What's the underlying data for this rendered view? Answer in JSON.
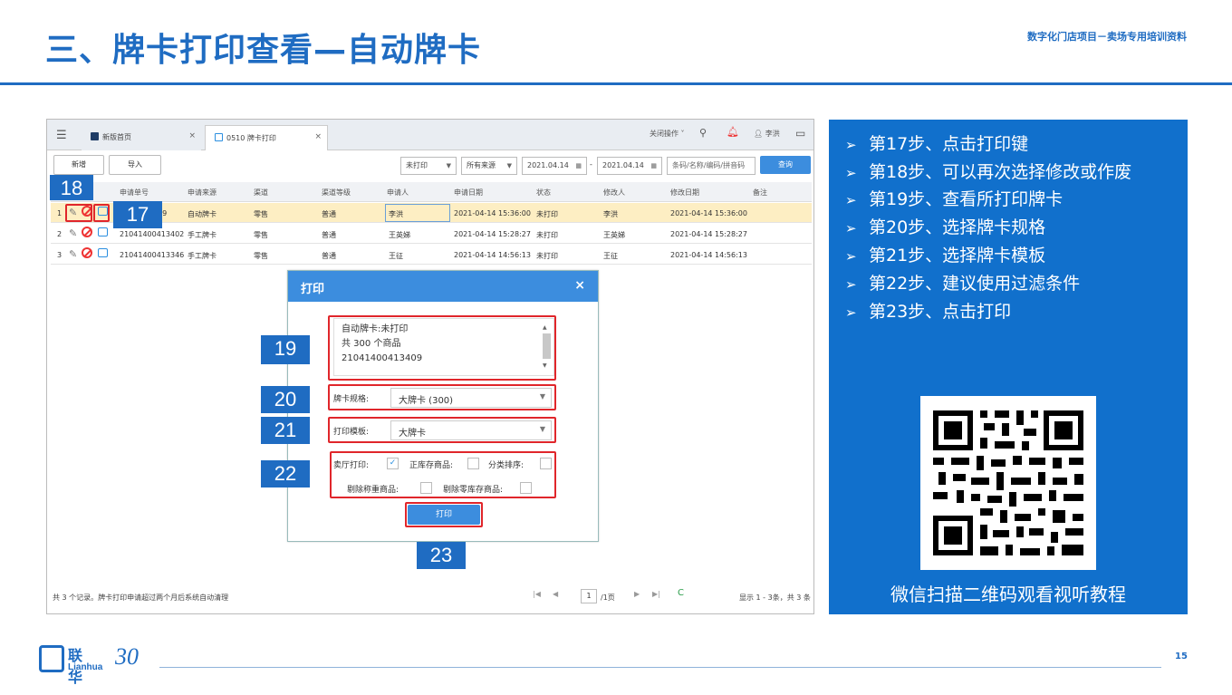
{
  "slide": {
    "title": "三、牌卡打印查看—自动牌卡",
    "subtitle": "数字化门店项目－卖场专用培训资料",
    "page_number": "15",
    "logo_cn": "联华",
    "logo_en": "Lianhua",
    "logo_30": "30"
  },
  "app": {
    "tabs": [
      {
        "label": "新版首页",
        "close": "×"
      },
      {
        "label": "0510 牌卡打印",
        "close": "×"
      }
    ],
    "topbar": {
      "close_ops": "关闭操作 ˅",
      "user": "李洪"
    },
    "toolbar": {
      "new_label": "新增",
      "import_label": "导入",
      "status_filter": "未打印",
      "source_filter": "所有来源",
      "date_from": "2021.04.14",
      "date_sep": "-",
      "date_to": "2021.04.14",
      "search_placeholder": "条码/名称/编码/拼音码",
      "query_label": "查询"
    },
    "columns": [
      "申请单号",
      "申请来源",
      "渠道",
      "渠道等级",
      "申请人",
      "申请日期",
      "状态",
      "修改人",
      "修改日期",
      "备注"
    ],
    "rows": [
      {
        "idx": "1",
        "id": "21041400413409",
        "id_visible": "409",
        "source": "自动牌卡",
        "channel": "零售",
        "level": "普通",
        "applicant": "李洪",
        "date": "2021-04-14 15:36:00",
        "status": "未打印",
        "modifier": "李洪",
        "mod_date": "2021-04-14 15:36:00"
      },
      {
        "idx": "2",
        "id": "21041400413402",
        "source": "手工牌卡",
        "channel": "零售",
        "level": "普通",
        "applicant": "王英娣",
        "date": "2021-04-14 15:28:27",
        "status": "未打印",
        "modifier": "王英娣",
        "mod_date": "2021-04-14 15:28:27"
      },
      {
        "idx": "3",
        "id": "21041400413346",
        "source": "手工牌卡",
        "channel": "零售",
        "level": "普通",
        "applicant": "王征",
        "date": "2021-04-14 14:56:13",
        "status": "未打印",
        "modifier": "王征",
        "mod_date": "2021-04-14 14:56:13"
      }
    ],
    "footer": {
      "record_note": "共 3 个记录。牌卡打印申请超过两个月后系统自动清理",
      "page": "1",
      "page_total": "/1页",
      "summary": "显示 1 - 3条，共 3 条"
    }
  },
  "dialog": {
    "title": "打印",
    "close": "×",
    "text_lines": [
      "自动牌卡:未打印",
      "共 300 个商品",
      "21041400413409"
    ],
    "spec_label": "牌卡规格:",
    "spec_value": "大牌卡 (300)",
    "template_label": "打印模板:",
    "template_value": "大牌卡",
    "opt_hall": "卖厅打印:",
    "opt_positive": "正库存商品:",
    "opt_sort": "分类排序:",
    "opt_weighed": "剔除称重商品:",
    "opt_zero": "剔除零库存商品:",
    "print_label": "打印"
  },
  "markers": {
    "m17": "17",
    "m18": "18",
    "m19": "19",
    "m20": "20",
    "m21": "21",
    "m22": "22",
    "m23": "23"
  },
  "panel": {
    "steps": [
      "第17步、点击打印键",
      "第18步、可以再次选择修改或作废",
      "第19步、查看所打印牌卡",
      "第20步、选择牌卡规格",
      "第21步、选择牌卡模板",
      "第22步、建议使用过滤条件",
      "第23步、点击打印"
    ],
    "qr_caption": "微信扫描二维码观看视听教程"
  },
  "colors": {
    "brand_blue": "#1f6cc2",
    "panel_blue": "#1170cc",
    "highlight_red": "#e0262b",
    "selected_row": "#fdeec3"
  }
}
